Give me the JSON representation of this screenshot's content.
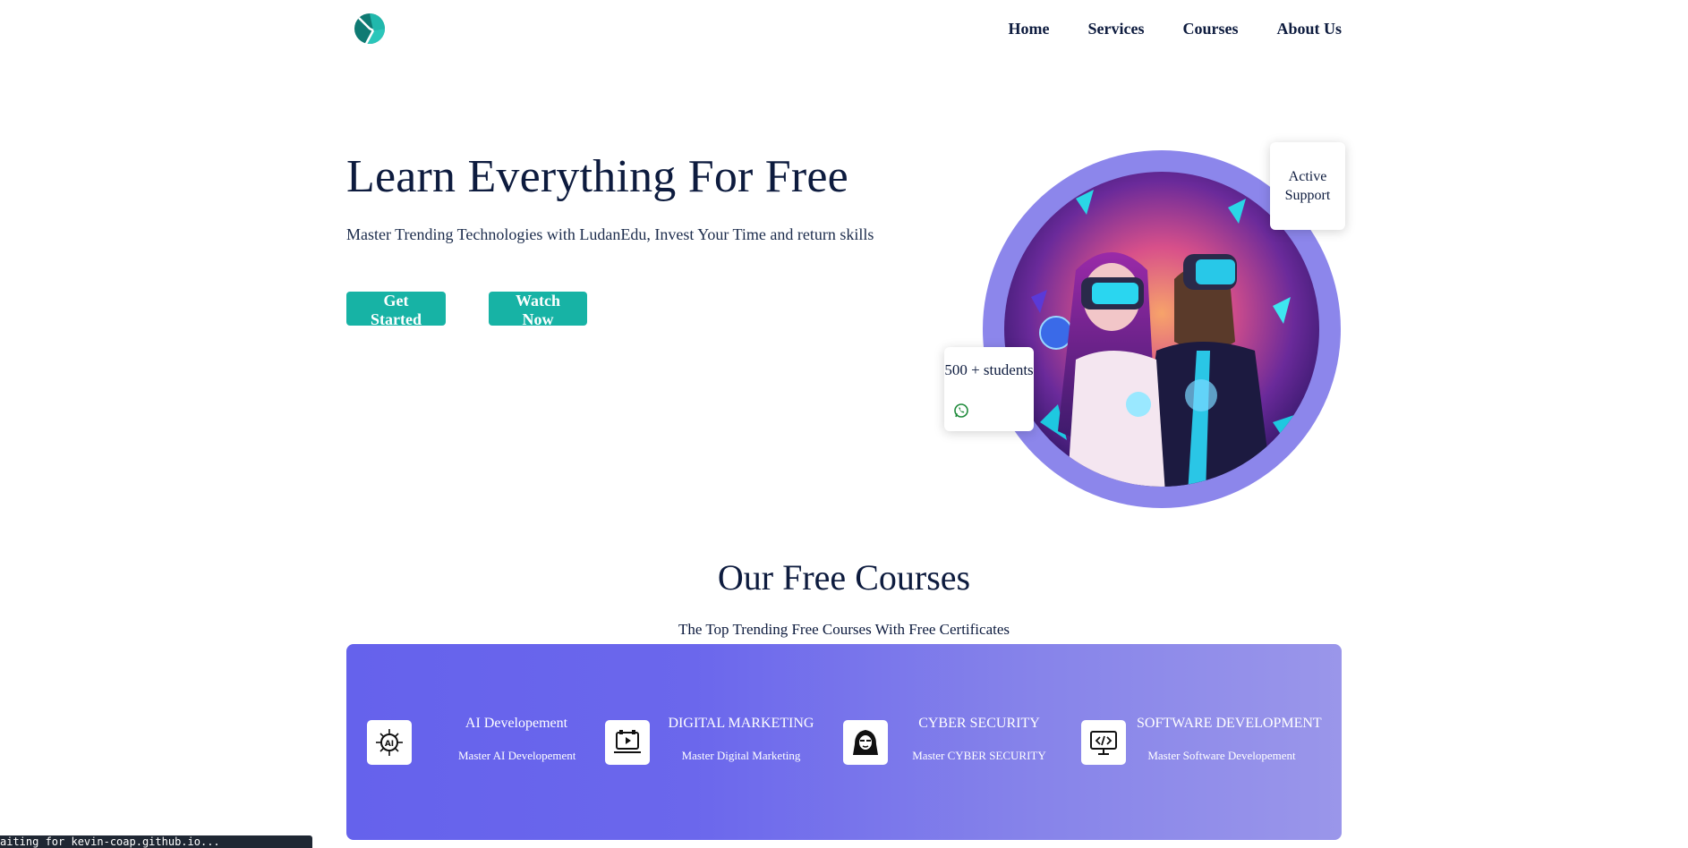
{
  "nav": {
    "items": [
      "Home",
      "Services",
      "Courses",
      "About Us"
    ]
  },
  "hero": {
    "title": "Learn Everything For Free",
    "subtitle": "Master Trending Technologies with LudanEdu, Invest Your Time and return skills",
    "primary_button": "Get Started",
    "secondary_button": "Watch Now",
    "support_card": "Active Support",
    "students_card": "500 + students"
  },
  "courses": {
    "title": "Our Free Courses",
    "subtitle": "The Top Trending Free Courses With Free Certificates",
    "items": [
      {
        "title": "AI Developement",
        "desc": "Master AI Developement",
        "icon": "ai-chip-icon"
      },
      {
        "title": "DIGITAL MARKETING",
        "desc": "Master Digital Marketing",
        "icon": "digital-marketing-icon"
      },
      {
        "title": "CYBER SECURITY",
        "desc": "Master CYBER SECURITY",
        "icon": "hacker-icon"
      },
      {
        "title": "SOFTWARE DEVELOPMENT",
        "desc": "Master Software Developement",
        "icon": "code-monitor-icon"
      }
    ]
  },
  "status_bar": "aiting for kevin-coap.github.io...",
  "colors": {
    "accent": "#17b3a5",
    "panel_start": "#6562ec",
    "panel_end": "#9a96ea",
    "circle": "#8c86eb",
    "text": "#0d1b3e"
  }
}
